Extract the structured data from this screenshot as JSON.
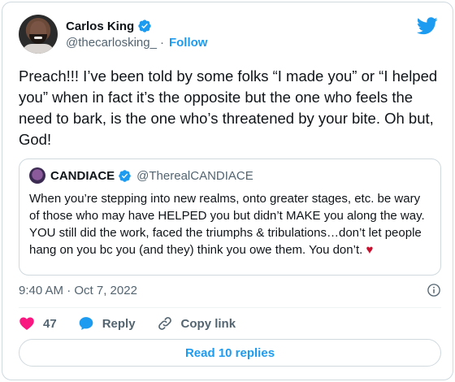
{
  "author": {
    "display_name": "Carlos King",
    "handle": "@thecarlosking_",
    "separator": "·",
    "follow_label": "Follow",
    "verified": true
  },
  "tweet": {
    "text": "Preach!!! I’ve been told by some folks “I made you” or “I helped you” when in fact it’s the opposite but the one who feels the need to bark, is the one who’s threatened by your bite. Oh but, God!"
  },
  "quote": {
    "display_name": "CANDIACE",
    "handle": "@TherealCANDIACE",
    "text": "When you’re stepping into new realms, onto greater stages, etc. be wary of those who may have HELPED you but didn’t MAKE you along the way. YOU still did the work, faced the triumphs & tribulations…don’t let people hang on you bc you (and they) think you owe them. You don’t.",
    "emoji": "♥"
  },
  "meta": {
    "timestamp": "9:40 AM · Oct 7, 2022"
  },
  "actions": {
    "like_count": "47",
    "reply_label": "Reply",
    "copy_link_label": "Copy link"
  },
  "footer": {
    "read_replies_label": "Read 10 replies"
  },
  "colors": {
    "brand_blue": "#1d9bf0",
    "like_red": "#f91880",
    "secondary_text": "#536471",
    "border": "#cfd9de"
  },
  "icons": [
    "twitter-bird-icon",
    "verified-badge-icon",
    "info-icon",
    "heart-icon",
    "reply-bubble-icon",
    "copy-link-icon"
  ]
}
